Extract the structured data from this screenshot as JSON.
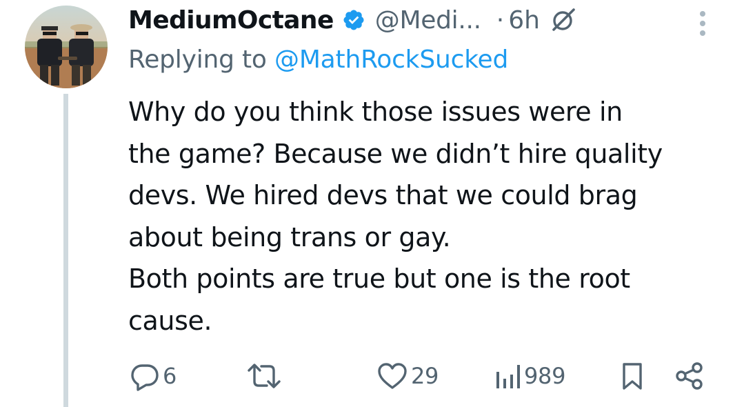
{
  "tweet": {
    "author": {
      "display_name": "MediumOctane",
      "handle": "@Medi...",
      "verified": true
    },
    "separator": "·",
    "timestamp": "6h",
    "replying": {
      "prefix": "Replying to",
      "mention": "@MathRockSucked"
    },
    "body_lines": [
      "Why do you think those issues were in",
      "the game? Because we didn’t hire quality",
      "devs. We hired devs that we could brag",
      "about being trans or gay.",
      "Both points are true but one is the root",
      "cause."
    ],
    "actions": {
      "replies": "6",
      "retweets": "",
      "likes": "29",
      "views": "989"
    }
  },
  "icons": {
    "avatar": "avatar-photo",
    "verified": "verified-badge-icon",
    "grok": "grok-icon",
    "more": "more-vertical-icon",
    "reply": "reply-icon",
    "retweet": "retweet-icon",
    "like": "heart-icon",
    "views": "views-icon",
    "bookmark": "bookmark-icon",
    "share": "share-icon"
  },
  "colors": {
    "accent": "#1d9bf0",
    "text": "#0f1419",
    "secondary": "#536471",
    "thread_line": "#cfd9de"
  }
}
